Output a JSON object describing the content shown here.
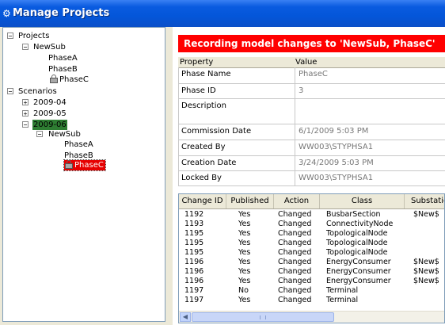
{
  "window": {
    "title": "Manage Projects",
    "icon": "app-icon"
  },
  "tree": {
    "projects_label": "Projects",
    "newsub_label": "NewSub",
    "phaseA": "PhaseA",
    "phaseB": "PhaseB",
    "phaseC": "PhaseC",
    "scenarios_label": "Scenarios",
    "scenario_2009_04": "2009-04",
    "scenario_2009_05": "2009-05",
    "scenario_2009_06": "2009-06",
    "s_newsub_label": "NewSub",
    "s_phaseA": "PhaseA",
    "s_phaseB": "PhaseB",
    "s_phaseC": "PhaseC",
    "expand_glyph": "+",
    "collapse_glyph": "−"
  },
  "banner": {
    "text": "Recording model changes to 'NewSub, PhaseC'",
    "color": "#FF0000"
  },
  "properties": {
    "header_property": "Property",
    "header_value": "Value",
    "rows": [
      {
        "label": "Phase Name",
        "value": "PhaseC"
      },
      {
        "label": "Phase ID",
        "value": "3"
      },
      {
        "label": "Description",
        "value": ""
      },
      {
        "label": "Commission Date",
        "value": "6/1/2009 5:03 PM"
      },
      {
        "label": "Created By",
        "value": "WW003\\STYPHSA1"
      },
      {
        "label": "Creation Date",
        "value": "3/24/2009 5:03 PM"
      },
      {
        "label": "Locked By",
        "value": "WW003\\STYPHSA1"
      }
    ]
  },
  "changes": {
    "columns": [
      "Change ID",
      "Published",
      "Action",
      "Class",
      "Substatio"
    ],
    "rows": [
      [
        "1192",
        "Yes",
        "Changed",
        "BusbarSection",
        "$New$"
      ],
      [
        "1193",
        "Yes",
        "Changed",
        "ConnectivityNode",
        ""
      ],
      [
        "1195",
        "Yes",
        "Changed",
        "TopologicalNode",
        ""
      ],
      [
        "1195",
        "Yes",
        "Changed",
        "TopologicalNode",
        ""
      ],
      [
        "1195",
        "Yes",
        "Changed",
        "TopologicalNode",
        ""
      ],
      [
        "1196",
        "Yes",
        "Changed",
        "EnergyConsumer",
        "$New$"
      ],
      [
        "1196",
        "Yes",
        "Changed",
        "EnergyConsumer",
        "$New$"
      ],
      [
        "1196",
        "Yes",
        "Changed",
        "EnergyConsumer",
        "$New$"
      ],
      [
        "1197",
        "No",
        "Changed",
        "Terminal",
        ""
      ],
      [
        "1197",
        "Yes",
        "Changed",
        "Terminal",
        ""
      ]
    ],
    "scroll_left": "◀",
    "scroll_grip": "≡"
  },
  "colors": {
    "titlebar": "#0456D9",
    "selected_scenario": "#2E7D32",
    "selected_phase": "#E60000",
    "banner": "#FF0000"
  }
}
